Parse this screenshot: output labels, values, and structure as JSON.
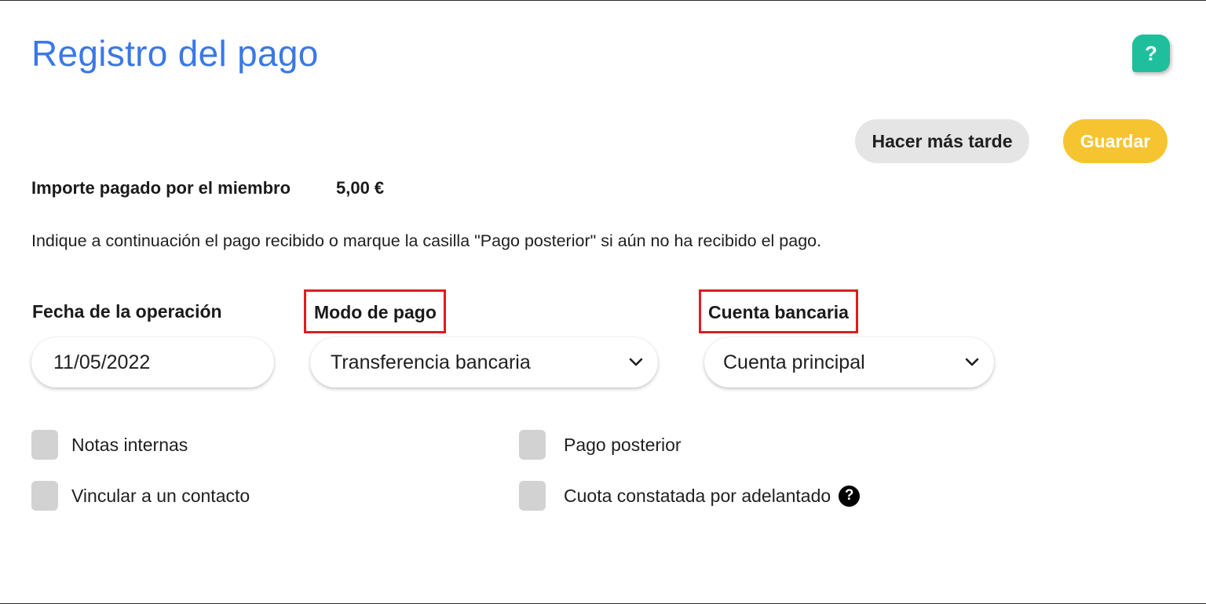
{
  "header": {
    "title": "Registro del pago",
    "help_glyph": "?",
    "help_icon": "question-mark-icon",
    "help_color": "#1fbf9d"
  },
  "actions": {
    "later_label": "Hacer más tarde",
    "save_label": "Guardar",
    "save_color": "#f7c431"
  },
  "summary": {
    "amount_label": "Importe pagado por el miembro",
    "amount_value": "5,00 €"
  },
  "instructions": "Indique a continuación el pago recibido o marque la casilla \"Pago posterior\" si aún no ha recibido el pago.",
  "form": {
    "date": {
      "label": "Fecha de la operación",
      "value": "11/05/2022"
    },
    "payment_mode": {
      "label": "Modo de pago",
      "selected": "Transferencia bancaria",
      "icon": "chevron-down-icon"
    },
    "bank_account": {
      "label": "Cuenta bancaria",
      "selected": "Cuenta principal",
      "icon": "chevron-down-icon"
    }
  },
  "checkboxes": {
    "internal_notes": {
      "label": "Notas internas",
      "checked": false
    },
    "link_contact": {
      "label": "Vincular a un contacto",
      "checked": false
    },
    "later_payment": {
      "label": "Pago posterior",
      "checked": false
    },
    "advance_fee": {
      "label": "Cuota constatada por adelantado",
      "checked": false,
      "info_glyph": "?",
      "info_icon": "question-circle-icon"
    }
  },
  "highlight_color": "#e01b22",
  "title_color": "#3b78e7"
}
